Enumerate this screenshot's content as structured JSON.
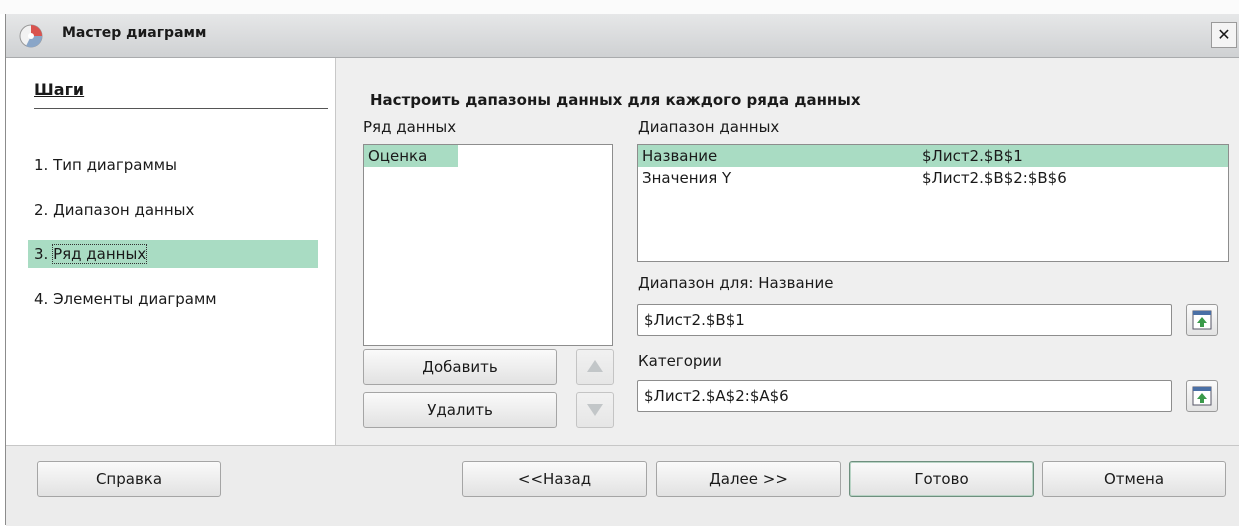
{
  "window": {
    "title": "Мастер диаграмм"
  },
  "sidebar": {
    "title": "Шаги",
    "steps": [
      {
        "label": "1. Тип диаграммы"
      },
      {
        "label": "2. Диапазон данных"
      },
      {
        "num": "3.",
        "label": "Ряд данных"
      },
      {
        "label": "4. Элементы диаграмм"
      }
    ],
    "active_step": 3
  },
  "main": {
    "title": "Настроить дапазоны данных для каждого ряда данных",
    "series_label": "Ряд данных",
    "series": [
      "Оценка"
    ],
    "ranges_label": "Диапазон данных",
    "ranges": [
      {
        "name": "Название",
        "range": "$Лист2.$B$1"
      },
      {
        "name": "Значения Y",
        "range": "$Лист2.$B$2:$B$6"
      }
    ],
    "range_for_label": "Диапазон для: Название",
    "range_for_value": "$Лист2.$B$1",
    "categories_label": "Категории",
    "categories_value": "$Лист2.$A$2:$A$6",
    "add_button": "Добавить",
    "remove_button": "Удалить"
  },
  "buttons": {
    "help": "Справка",
    "back": "<<Назад",
    "next": "Далее >>",
    "finish": "Готово",
    "cancel": "Отмена"
  },
  "colors": {
    "selection": "#a9dcc3"
  },
  "icons": {
    "up": "triangle-up",
    "down": "triangle-down",
    "range_select": "shrink-dialog-icon"
  }
}
